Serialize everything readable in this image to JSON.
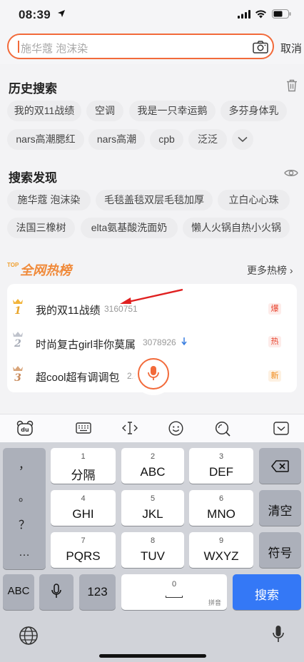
{
  "status": {
    "time": "08:39"
  },
  "search": {
    "placeholder": "施华蔻 泡沫染",
    "cancel": "取消"
  },
  "history": {
    "title": "历史搜索",
    "items": [
      "我的双11战绩",
      "空调",
      "我是一只幸运鹅",
      "多芬身体乳",
      "nars高潮腮红",
      "nars高潮",
      "cpb",
      "泛泛"
    ]
  },
  "discover": {
    "title": "搜索发现",
    "items": [
      "施华蔻 泡沫染",
      "毛毯盖毯双层毛毯加厚",
      "立白心心珠",
      "法国三橡树",
      "elta氨基酸洗面奶",
      "懒人火锅自热小火锅"
    ]
  },
  "hot": {
    "logo_top": "TOP",
    "logo_text": "全网热榜",
    "more": "更多热榜 ›",
    "items": [
      {
        "rank": "1",
        "title": "我的双11战绩",
        "count": "3160751",
        "tag": "爆",
        "trend": "up"
      },
      {
        "rank": "2",
        "title": "时尚复古girl非你莫属",
        "count": "3078926",
        "tag": "热",
        "trend": "down"
      },
      {
        "rank": "3",
        "title": "超cool超有调调包",
        "count": "22",
        "tag": "新",
        "trend": ""
      }
    ]
  },
  "keyboard": {
    "punct": [
      "，",
      "。",
      "？",
      "…"
    ],
    "rows": [
      [
        {
          "num": "1",
          "label": "分隔"
        },
        {
          "num": "2",
          "label": "ABC"
        },
        {
          "num": "3",
          "label": "DEF"
        }
      ],
      [
        {
          "num": "4",
          "label": "GHI"
        },
        {
          "num": "5",
          "label": "JKL"
        },
        {
          "num": "6",
          "label": "MNO"
        }
      ],
      [
        {
          "num": "7",
          "label": "PQRS"
        },
        {
          "num": "8",
          "label": "TUV"
        },
        {
          "num": "9",
          "label": "WXYZ"
        }
      ]
    ],
    "clear": "清空",
    "symbol": "符号",
    "abc": "ABC",
    "num123": "123",
    "space_num": "0",
    "space_hint": "拼音",
    "search": "搜索"
  },
  "colors": {
    "accent": "#f26a3a",
    "blue": "#3478f6",
    "hot_red": "#e8452f",
    "new_orange": "#f08a1a"
  }
}
